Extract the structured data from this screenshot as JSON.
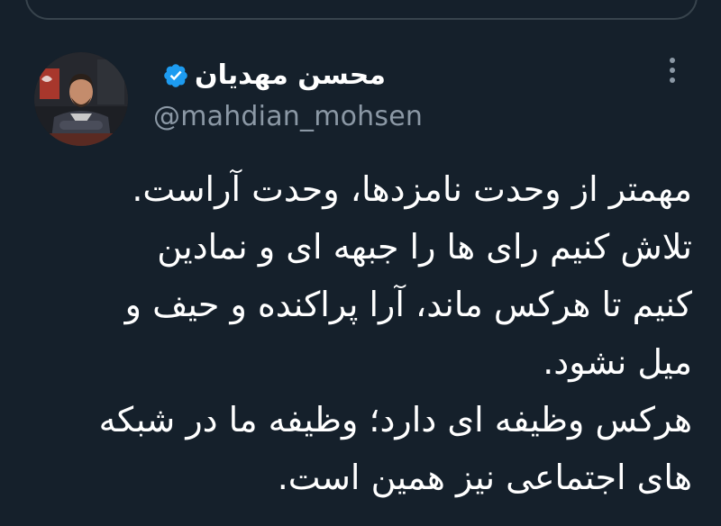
{
  "tweet": {
    "display_name": "محسن مهدیان",
    "handle": "@mahdian_mohsen",
    "verified": true,
    "icons": {
      "verified": "verified-badge-icon",
      "more": "more-options-icon"
    },
    "text_lines": [
      "مهمتر از وحدت نامزدها، وحدت آراست.",
      "تلاش کنیم رای ها را جبهه ای و نمادین",
      "کنیم تا هرکس ماند، آرا پراکنده و حیف و",
      "میل نشود.",
      "هرکس وظیفه ای دارد؛ وظیفه ما در شبکه",
      "های اجتماعی نیز همین است."
    ]
  },
  "colors": {
    "background": "#15202b",
    "text": "#ffffff",
    "secondary_text": "#8b98a5",
    "verified_blue": "#1d9bf0",
    "border": "#38444d"
  }
}
